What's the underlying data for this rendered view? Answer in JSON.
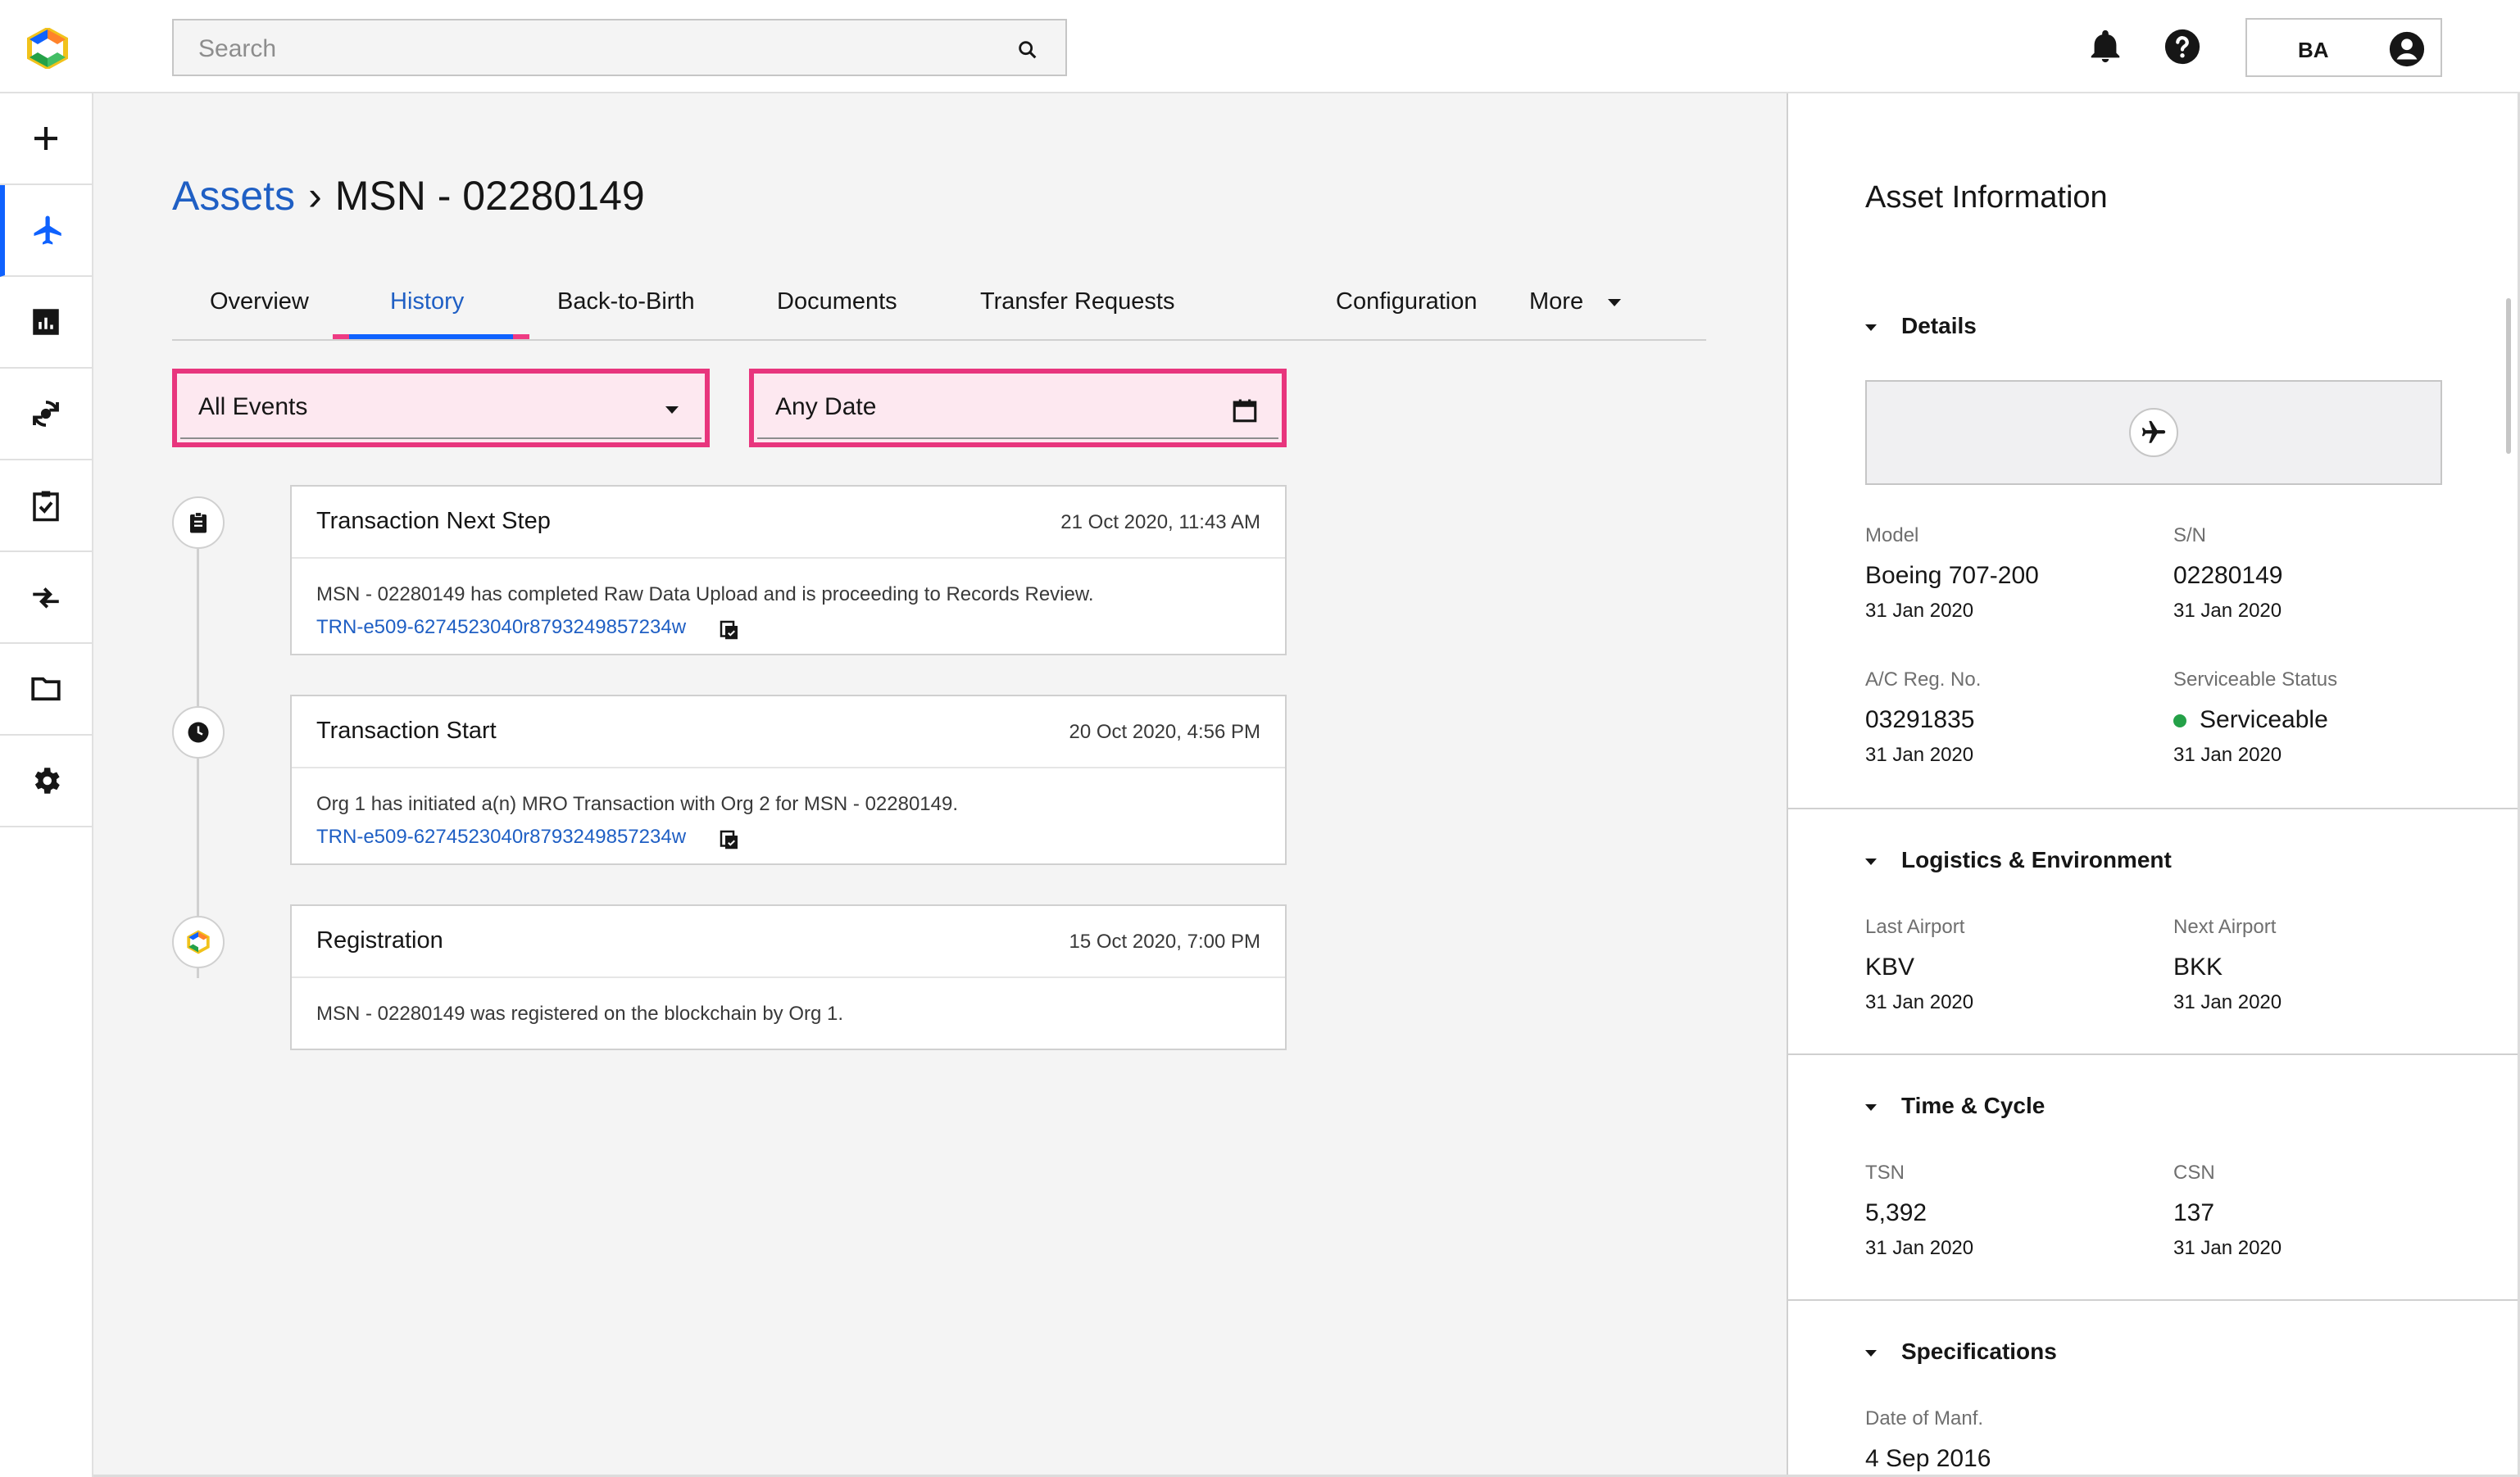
{
  "header": {
    "search_placeholder": "Search",
    "user_initials": "BA"
  },
  "breadcrumb": {
    "root": "Assets",
    "separator": "›",
    "current": "MSN - 02280149"
  },
  "tabs": [
    {
      "label": "Overview"
    },
    {
      "label": "History",
      "active": true
    },
    {
      "label": "Back-to-Birth"
    },
    {
      "label": "Documents"
    },
    {
      "label": "Transfer Requests"
    },
    {
      "label": "Configuration"
    },
    {
      "label": "More"
    }
  ],
  "filters": {
    "events": "All Events",
    "date": "Any Date"
  },
  "events": [
    {
      "title": "Transaction Next Step",
      "date": "21 Oct 2020, 11:43 AM",
      "text": "MSN - 02280149 has completed Raw Data Upload and is proceeding to Records Review.",
      "link": "TRN-e509-6274523040r8793249857234w",
      "icon": "clipboard-icon"
    },
    {
      "title": "Transaction Start",
      "date": "20 Oct 2020, 4:56 PM",
      "text": "Org 1 has initiated a(n) MRO Transaction with Org 2 for MSN - 02280149.",
      "link": "TRN-e509-6274523040r8793249857234w",
      "icon": "clock-icon"
    },
    {
      "title": "Registration",
      "date": "15 Oct 2020, 7:00 PM",
      "text": "MSN - 02280149 was registered on the blockchain by Org 1.",
      "icon": "logo-icon"
    }
  ],
  "panel": {
    "title": "Asset Information",
    "sections": {
      "details": {
        "title": "Details",
        "model": {
          "label": "Model",
          "value": "Boeing 707-200",
          "date": "31 Jan 2020"
        },
        "sn": {
          "label": "S/N",
          "value": "02280149",
          "date": "31 Jan 2020"
        },
        "reg": {
          "label": "A/C Reg. No.",
          "value": "03291835",
          "date": "31 Jan 2020"
        },
        "status": {
          "label": "Serviceable Status",
          "value": "Serviceable",
          "date": "31 Jan 2020",
          "color": "#24a148"
        }
      },
      "logistics": {
        "title": "Logistics & Environment",
        "last": {
          "label": "Last Airport",
          "value": "KBV",
          "date": "31 Jan 2020"
        },
        "next": {
          "label": "Next Airport",
          "value": "BKK",
          "date": "31 Jan 2020"
        }
      },
      "time": {
        "title": "Time & Cycle",
        "tsn": {
          "label": "TSN",
          "value": "5,392",
          "date": "31 Jan 2020"
        },
        "csn": {
          "label": "CSN",
          "value": "137",
          "date": "31 Jan 2020"
        }
      },
      "specs": {
        "title": "Specifications",
        "manf": {
          "label": "Date of Manf.",
          "value": "4 Sep 2016"
        }
      }
    }
  },
  "colors": {
    "accent": "#0f62fe",
    "link": "#1f5fc4",
    "highlight": "#e8357d"
  }
}
